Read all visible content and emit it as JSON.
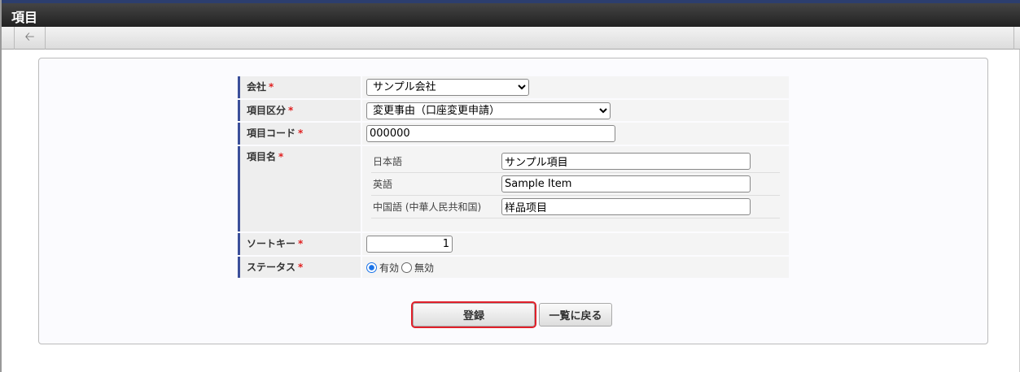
{
  "header": {
    "title": "項目"
  },
  "toolbar": {
    "back_icon": "arrow-left-icon"
  },
  "form": {
    "required_mark": "*",
    "company": {
      "label": "会社",
      "value": "サンプル会社"
    },
    "category": {
      "label": "項目区分",
      "value": "変更事由（口座変更申請）"
    },
    "code": {
      "label": "項目コード",
      "value": "000000"
    },
    "name": {
      "label": "項目名",
      "locales": [
        {
          "label": "日本語",
          "value": "サンプル項目"
        },
        {
          "label": "英語",
          "value": "Sample Item"
        },
        {
          "label": "中国語 (中華人民共和国)",
          "value": "样品项目"
        }
      ]
    },
    "sort_key": {
      "label": "ソートキー",
      "value": "1"
    },
    "status": {
      "label": "ステータス",
      "options": [
        "有効",
        "無効"
      ],
      "selected": "有効"
    }
  },
  "buttons": {
    "register": "登録",
    "back_to_list": "一覧に戻る"
  }
}
